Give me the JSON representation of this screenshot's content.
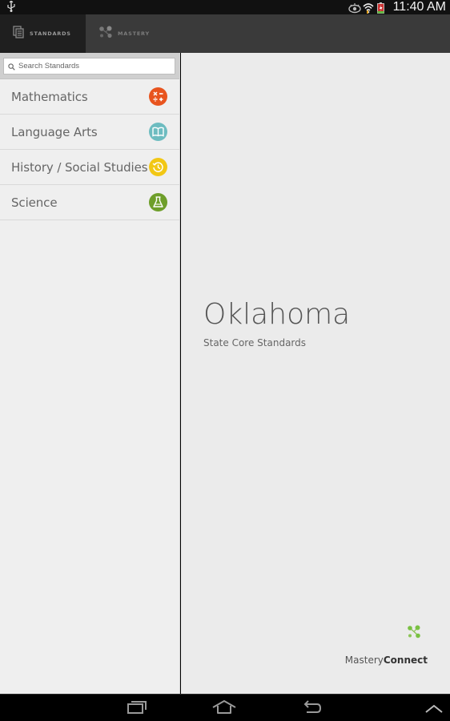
{
  "status_bar": {
    "time": "11:40 AM",
    "icons": [
      "usb-icon",
      "eye-icon",
      "wifi-icon",
      "battery-charging-icon"
    ]
  },
  "tabs": [
    {
      "label": "STANDARDS",
      "icon": "documents-icon",
      "active": true
    },
    {
      "label": "MASTERY",
      "icon": "mastery-dots-icon",
      "active": false
    }
  ],
  "sidebar": {
    "search": {
      "placeholder": "Search Standards",
      "value": ""
    },
    "subjects": [
      {
        "label": "Mathematics",
        "icon": "math-operators-icon",
        "color": "#e8541e"
      },
      {
        "label": "Language Arts",
        "icon": "book-icon",
        "color": "#6dbcc0"
      },
      {
        "label": "History / Social Studies",
        "icon": "history-clock-icon",
        "color": "#f2c714"
      },
      {
        "label": "Science",
        "icon": "flask-icon",
        "color": "#6e9e2a"
      }
    ]
  },
  "main": {
    "state": "Oklahoma",
    "subtitle": "State Core Standards",
    "brand": {
      "part1": "Mastery",
      "part2": "Connect",
      "color": "#7ac143"
    }
  },
  "nav_bar": {
    "buttons": [
      "recent-apps",
      "home",
      "back",
      "menu-up"
    ]
  }
}
